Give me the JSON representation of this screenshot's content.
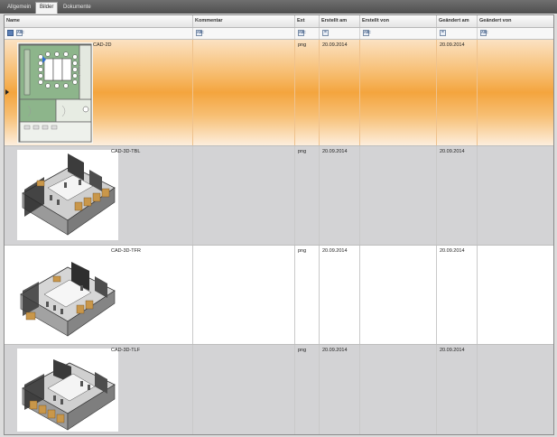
{
  "tabs": [
    {
      "label": "Allgemein",
      "active": false
    },
    {
      "label": "Bilder",
      "active": true
    },
    {
      "label": "Dokumente",
      "active": false
    }
  ],
  "columns": {
    "name": "Name",
    "kommentar": "Kommentar",
    "ext": "Ext",
    "erstellt_am": "Erstellt am",
    "erstellt_von": "Erstellt von",
    "geaendert_am": "Geändert am",
    "geaendert_von": "Geändert von"
  },
  "filter": {
    "text_symbol": "ᴀʙᴄ",
    "equals_symbol": "="
  },
  "rows": [
    {
      "name": "CAD-2D",
      "kommentar": "",
      "ext": "png",
      "erstellt_am": "20.09.2014",
      "erstellt_von": "",
      "geaendert_am": "20.09.2014",
      "geaendert_von": "",
      "thumbnail": "floorplan-2d-image",
      "selected": true
    },
    {
      "name": "CAD-3D-TBL",
      "kommentar": "",
      "ext": "png",
      "erstellt_am": "20.09.2014",
      "erstellt_von": "",
      "geaendert_am": "20.09.2014",
      "geaendert_von": "",
      "thumbnail": "room-3d-image",
      "selected": false
    },
    {
      "name": "CAD-3D-TFR",
      "kommentar": "",
      "ext": "png",
      "erstellt_am": "20.09.2014",
      "erstellt_von": "",
      "geaendert_am": "20.09.2014",
      "geaendert_von": "",
      "thumbnail": "room-3d-image",
      "selected": false
    },
    {
      "name": "CAD-3D-TLF",
      "kommentar": "",
      "ext": "png",
      "erstellt_am": "20.09.2014",
      "erstellt_von": "",
      "geaendert_am": "20.09.2014",
      "geaendert_von": "",
      "thumbnail": "room-3d-image",
      "selected": false
    }
  ],
  "colors": {
    "selection_orange": "#f4a53e",
    "row_gray": "#d3d3d5",
    "tabbar_dark": "#5a5a5a"
  }
}
